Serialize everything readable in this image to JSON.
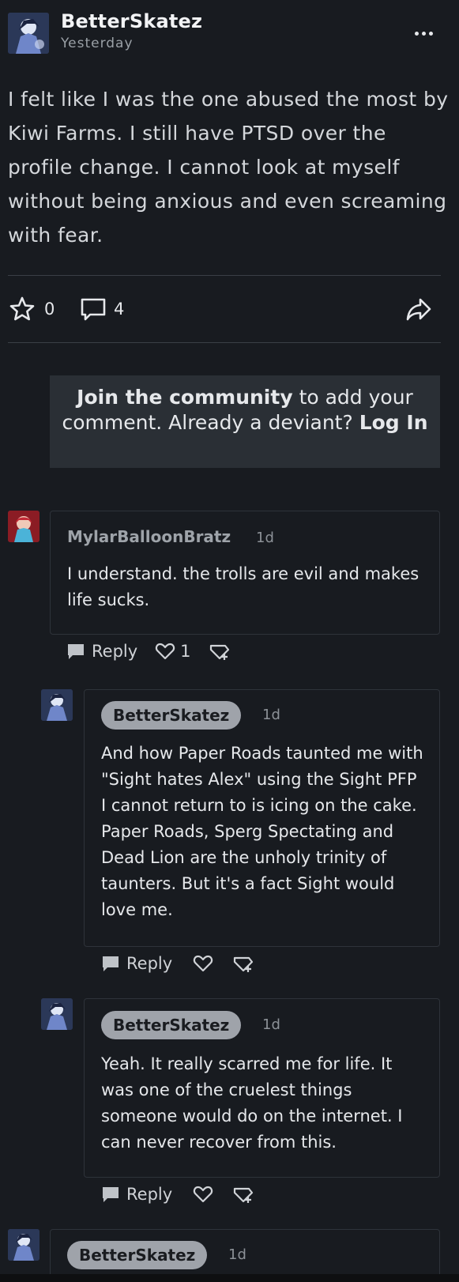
{
  "post": {
    "author": "BetterSkatez",
    "time": "Yesterday",
    "body": "I felt like I was the one abused the most by Kiwi Farms. I still have PTSD over the profile change. I cannot look at myself without being anxious and even screaming with fear.",
    "favorites": "0",
    "comments": "4"
  },
  "join": {
    "bold1": "Join the community",
    "middle": " to add your comment. Already a deviant? ",
    "bold2": "Log In"
  },
  "comments": [
    {
      "author": "MylarBalloonBratz",
      "time": "1d",
      "text": "I understand. the trolls are evil and makes life sucks.",
      "reply_label": "Reply",
      "likes": "1"
    },
    {
      "author": "BetterSkatez",
      "time": "1d",
      "text": "And how Paper Roads taunted me with \"Sight hates Alex\" using the Sight PFP I cannot return to is icing on the cake. Paper Roads, Sperg Spectating and Dead Lion are the unholy trinity of taunters. But it's a fact Sight would love me.",
      "reply_label": "Reply"
    },
    {
      "author": "BetterSkatez",
      "time": "1d",
      "text": "Yeah. It really scarred me for life. It was one of the cruelest things someone would do on the internet. I can never recover from this.",
      "reply_label": "Reply"
    },
    {
      "author": "BetterSkatez",
      "time": "1d"
    }
  ],
  "colors": {
    "background": "#181b20",
    "card_border": "#2e333a",
    "pill": "#9fa3aa",
    "join_box": "#2a2f35"
  },
  "icons": [
    "more-dots-icon",
    "star-icon",
    "comment-bubble-icon",
    "share-arrow-icon",
    "reply-bubble-icon",
    "heart-icon",
    "gift-badge-icon"
  ]
}
